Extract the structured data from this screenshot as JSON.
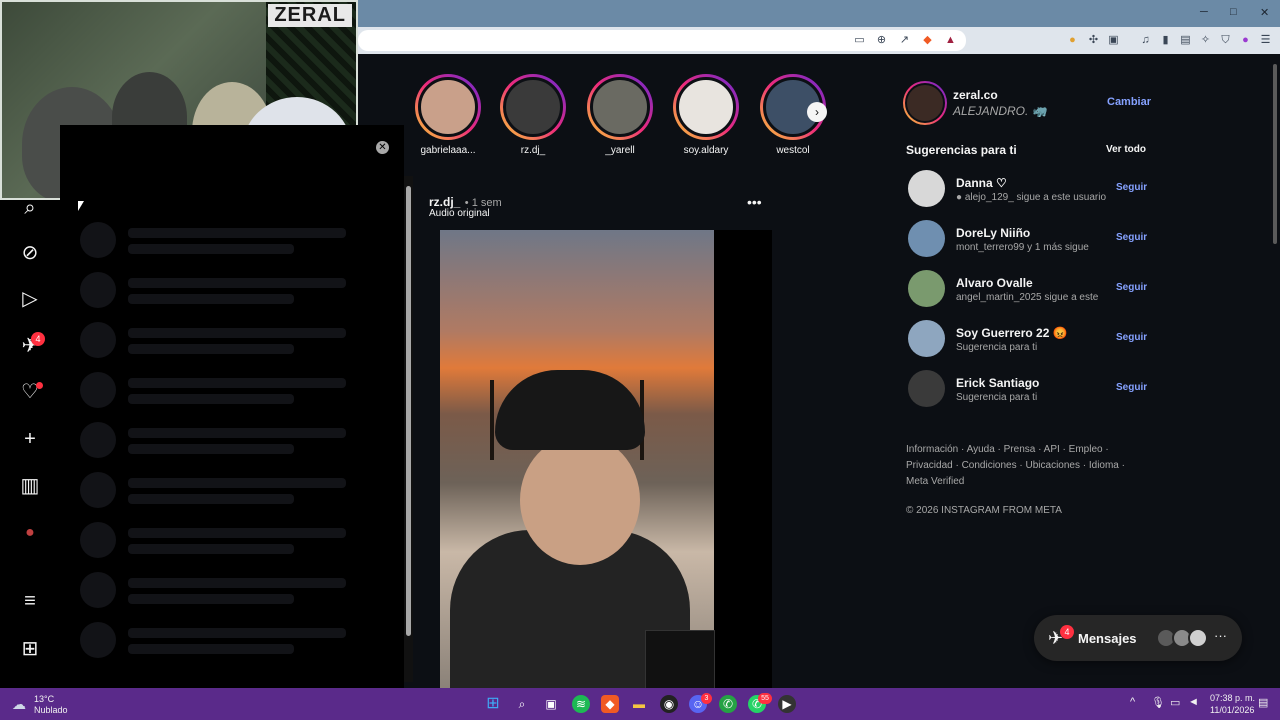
{
  "browser": {
    "window_controls": [
      "─",
      "□",
      "✕"
    ]
  },
  "webcam": {
    "overlay_text": "ZERAL"
  },
  "stories": [
    {
      "name": "gabrielaaa...",
      "color": "#c9a08a"
    },
    {
      "name": "rz.dj_",
      "color": "#3a3a3a"
    },
    {
      "name": "_yarell",
      "color": "#6a6a62"
    },
    {
      "name": "soy.aldary",
      "color": "#e8e4df"
    },
    {
      "name": "westcol",
      "color": "#3d4f66"
    }
  ],
  "post": {
    "username": "rz.dj_",
    "time": "• 1 sem",
    "audio": "Audio original",
    "more_label": "•••"
  },
  "sidebar": {
    "direct_badge": "4"
  },
  "profile": {
    "username": "zeral.co",
    "name": "ALEJANDRO. 🦏",
    "switch_label": "Cambiar"
  },
  "suggestions": {
    "title": "Sugerencias para ti",
    "see_all": "Ver todo",
    "items": [
      {
        "username": "Danna ♡",
        "subtitle": "● alejo_129_ sigue a este usuario",
        "follow": "Seguir",
        "color": "#d8d8d8"
      },
      {
        "username": "DoreLy Niiño",
        "subtitle": "mont_terrero99 y 1 más sigue",
        "follow": "Seguir",
        "color": "#6f8fb0"
      },
      {
        "username": "Alvaro Ovalle",
        "subtitle": "angel_martin_2025 sigue a este",
        "follow": "Seguir",
        "color": "#7a9a6e"
      },
      {
        "username": "Soy Guerrero 22 😡",
        "subtitle": "Sugerencia para ti",
        "follow": "Seguir",
        "color": "#8ea6bf"
      },
      {
        "username": "Erick Santiago",
        "subtitle": "Sugerencia para ti",
        "follow": "Seguir",
        "color": "#3a3a3a"
      }
    ]
  },
  "footer": {
    "links": "Información · Ayuda · Prensa · API · Empleo · Privacidad · Condiciones · Ubicaciones · Idioma · Meta Verified",
    "copyright": "© 2026 INSTAGRAM FROM META"
  },
  "messages": {
    "label": "Mensajes",
    "badge": "4",
    "more": "···"
  },
  "taskbar": {
    "temp": "13°C",
    "condition": "Nublado",
    "time": "07:38 p. m.",
    "date": "11/01/2026",
    "discord_badge": "3",
    "whatsapp_badge": "55"
  }
}
